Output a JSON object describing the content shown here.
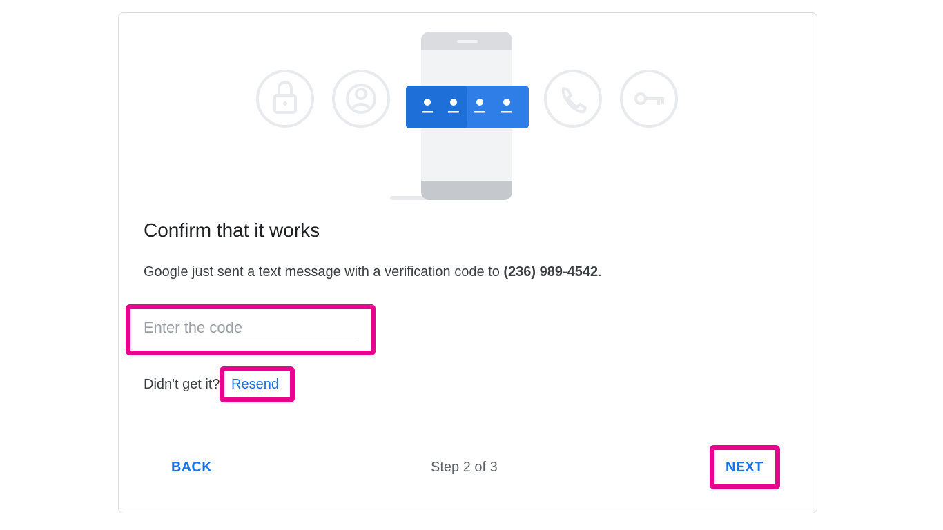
{
  "dialog": {
    "title": "Confirm that it works",
    "description_prefix": "Google just sent a text message with a verification code to ",
    "phone_number": "(236) 989-4542",
    "description_suffix": ".",
    "code_input": {
      "placeholder": "Enter the code",
      "value": ""
    },
    "resend_prompt": "Didn't get it?",
    "resend_label": "Resend",
    "back_label": "BACK",
    "next_label": "NEXT",
    "step_text": "Step 2 of 3"
  },
  "illustration": {
    "icons": [
      "lock-icon",
      "account-circle-icon",
      "phone-icon",
      "key-icon"
    ],
    "code_dots": 4
  },
  "colors": {
    "accent": "#1a73e8",
    "highlight": "#e6058c",
    "code_box": "#2f7de6"
  }
}
